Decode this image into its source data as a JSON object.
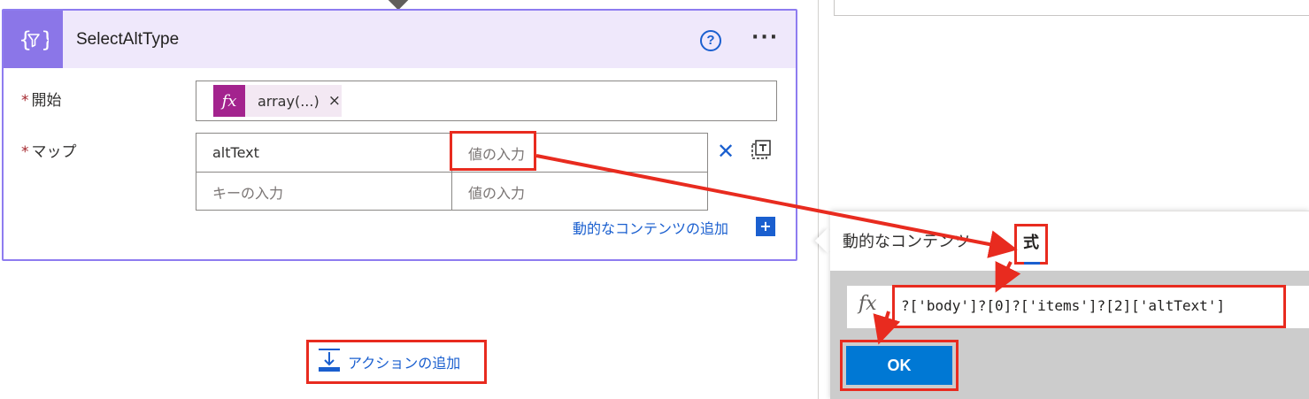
{
  "card": {
    "title": "SelectAltType",
    "icon": "curly-filter-icon",
    "help_icon": "question-circle-icon",
    "more_icon": "ellipsis-icon",
    "more_label": "···",
    "help_label": "?"
  },
  "fields": {
    "required_mark": "*",
    "start_label": "開始",
    "start_token": {
      "fx_label": "fx",
      "label": "array(...)",
      "remove_label": "×"
    },
    "map_label": "マップ",
    "map_rows": [
      {
        "key": "altText",
        "value_placeholder": "値の入力"
      },
      {
        "key_placeholder": "キーの入力",
        "value_placeholder": "値の入力"
      }
    ],
    "map_close_label": "✕",
    "add_dynamic_label": "動的なコンテンツの追加",
    "add_dynamic_plus": "+"
  },
  "add_action": {
    "label": "アクションの追加"
  },
  "expression_panel": {
    "tab_dynamic": "動的なコンテンツ",
    "tab_expression": "式",
    "fx_label": "fx",
    "expression_text": "?['body']?[0]?['items']?[2]['altText']",
    "ok_label": "OK"
  },
  "colors": {
    "accent": "#1a5fcf",
    "card_header": "#efe8fb",
    "card_icon_bg": "#8b76e8",
    "card_border": "#8e7cf0",
    "token_fx": "#a3238e",
    "highlight": "#e82b1f",
    "ok_button": "#0078d4"
  }
}
